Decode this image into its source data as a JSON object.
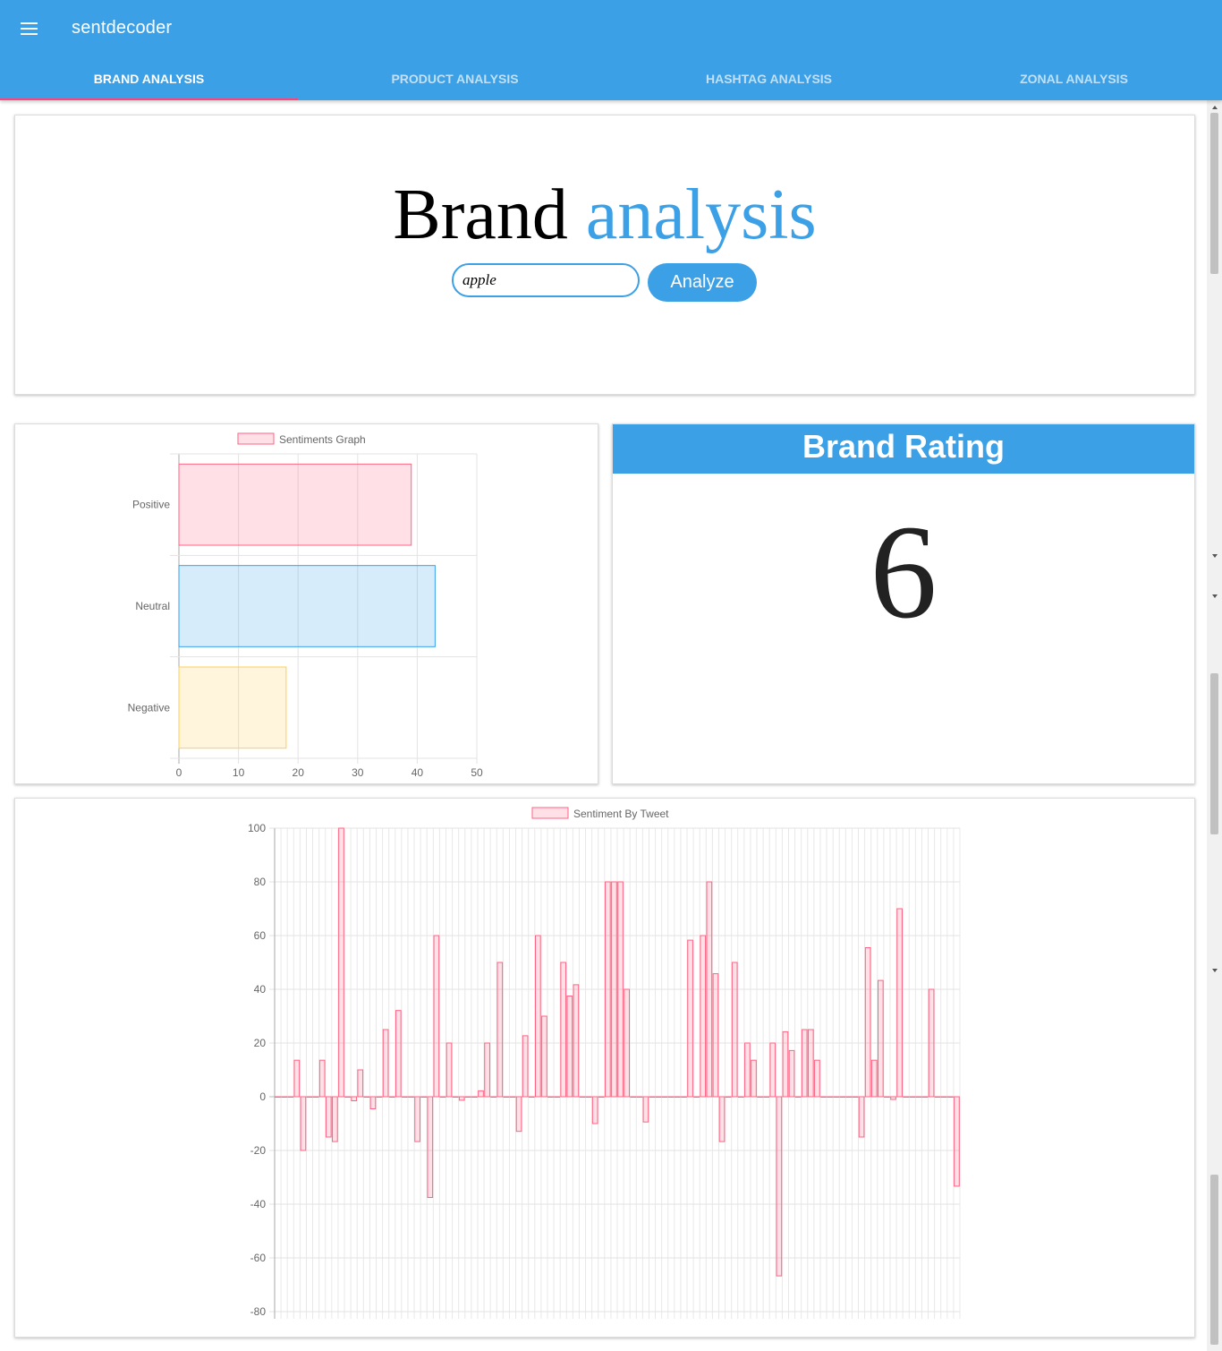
{
  "app": {
    "title": "sentdecoder"
  },
  "tabs": [
    {
      "label": "BRAND ANALYSIS",
      "active": true
    },
    {
      "label": "PRODUCT ANALYSIS",
      "active": false
    },
    {
      "label": "HASHTAG ANALYSIS",
      "active": false
    },
    {
      "label": "ZONAL ANALYSIS",
      "active": false
    }
  ],
  "hero": {
    "title_part1": "Brand",
    "title_part2": "analysis",
    "search_value": "apple",
    "analyze_label": "Analyze"
  },
  "rating": {
    "header": "Brand Rating",
    "value": "6"
  },
  "colors": {
    "primary": "#3ba0e6",
    "tab_indicator": "#ff4081",
    "positive": "#ff6384",
    "neutral": "#36a2eb",
    "negative": "#ffce56"
  },
  "chart_data": [
    {
      "type": "bar",
      "orientation": "horizontal",
      "legend": "Sentiments Graph",
      "categories": [
        "Positive",
        "Neutral",
        "Negative"
      ],
      "values": [
        39,
        43,
        18
      ],
      "xlim": [
        0,
        50
      ],
      "xticks": [
        0,
        10,
        20,
        30,
        40,
        50
      ],
      "legend_position": "top",
      "grid": true
    },
    {
      "type": "bar",
      "legend": "Sentiment By Tweet",
      "ylim": [
        -80,
        100
      ],
      "yticks": [
        100,
        80,
        60,
        40,
        20,
        0,
        -20,
        -40,
        -60,
        -80
      ],
      "legend_position": "top",
      "grid": true,
      "values": [
        0,
        0,
        0,
        13.6,
        -20,
        0,
        0,
        13.6,
        -15,
        -16.7,
        100,
        0,
        -1.5,
        10,
        0,
        -4.5,
        0,
        25,
        0,
        32.1,
        0,
        0,
        -16.7,
        0,
        -37.5,
        60,
        0,
        20,
        0,
        -1.3,
        0,
        0,
        2.2,
        20,
        0,
        50,
        0,
        0,
        -12.9,
        22.7,
        0,
        60,
        30,
        0,
        0,
        50,
        37.5,
        41.7,
        0,
        0,
        -10,
        0,
        80,
        80,
        80,
        40,
        0,
        0,
        -9.4,
        0,
        0,
        0,
        0,
        0,
        0,
        58.3,
        0,
        60,
        80,
        45.8,
        -16.7,
        0,
        50,
        0,
        20,
        13.6,
        0,
        0,
        20,
        -66.7,
        24.2,
        17.2,
        0,
        25,
        25,
        13.6,
        0,
        0,
        0,
        0,
        0,
        0,
        -15,
        55.5,
        13.6,
        43.3,
        0,
        -1,
        70,
        0,
        0,
        0,
        0,
        40,
        0,
        0,
        0,
        -33.3
      ]
    }
  ]
}
